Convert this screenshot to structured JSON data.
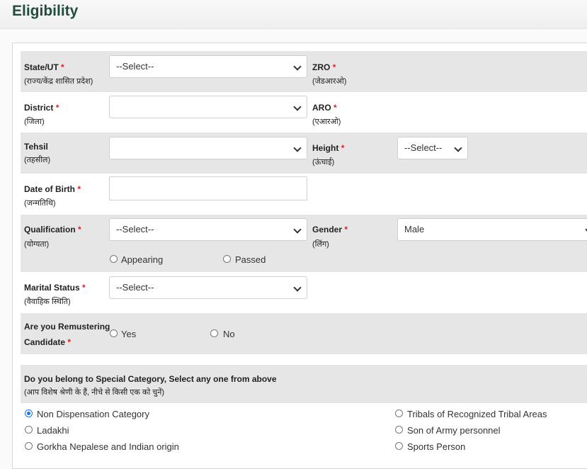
{
  "page": {
    "title": "Eligibility"
  },
  "form": {
    "state": {
      "label": "State/UT",
      "hindi": "(राज्य/केंद्र शासित प्रदेश)",
      "value": "--Select--"
    },
    "zro": {
      "label": "ZRO",
      "hindi": "(जेडआरओ)"
    },
    "district": {
      "label": "District",
      "hindi": "(जिला)",
      "value": ""
    },
    "aro": {
      "label": "ARO",
      "hindi": "(एआरओ)"
    },
    "tehsil": {
      "label": "Tehsil",
      "hindi": "(तहसील)",
      "value": ""
    },
    "height": {
      "label": "Height",
      "hindi": "(ऊंचाई)",
      "value": "--Select--"
    },
    "dob": {
      "label": "Date of Birth",
      "hindi": "(जन्मतिथि)",
      "value": ""
    },
    "qualification": {
      "label": "Qualification",
      "hindi": "(योग्यता)",
      "value": "--Select--",
      "options": [
        "Appearing",
        "Passed"
      ]
    },
    "gender": {
      "label": "Gender",
      "hindi": "(लिंग)",
      "value": "Male"
    },
    "marital": {
      "label": "Marital Status",
      "hindi": "(वैवाहिक स्थिति)",
      "value": "--Select--"
    },
    "remustering": {
      "label_line1": "Are you Remustering",
      "label_line2": "Candidate",
      "options": [
        "Yes",
        "No"
      ]
    },
    "special_category": {
      "heading": "Do you belong to Special Category, Select any one from above",
      "hindi": "(आप विशेष श्रेणी के हैं, नीचे से किसी एक को चुनें)",
      "options_left": [
        "Non Dispensation Category",
        "Ladakhi",
        "Gorkha Nepalese and Indian origin"
      ],
      "options_right": [
        "Tribals of Recognized Tribal Areas",
        "Son of Army personnel",
        "Sports Person"
      ],
      "selected": "Non Dispensation Category"
    }
  },
  "colors": {
    "title": "#1f4e3d",
    "required": "#e02020",
    "band": "#e6e6e6",
    "radio_selected": "#1a73e8"
  },
  "required_mark": "*"
}
